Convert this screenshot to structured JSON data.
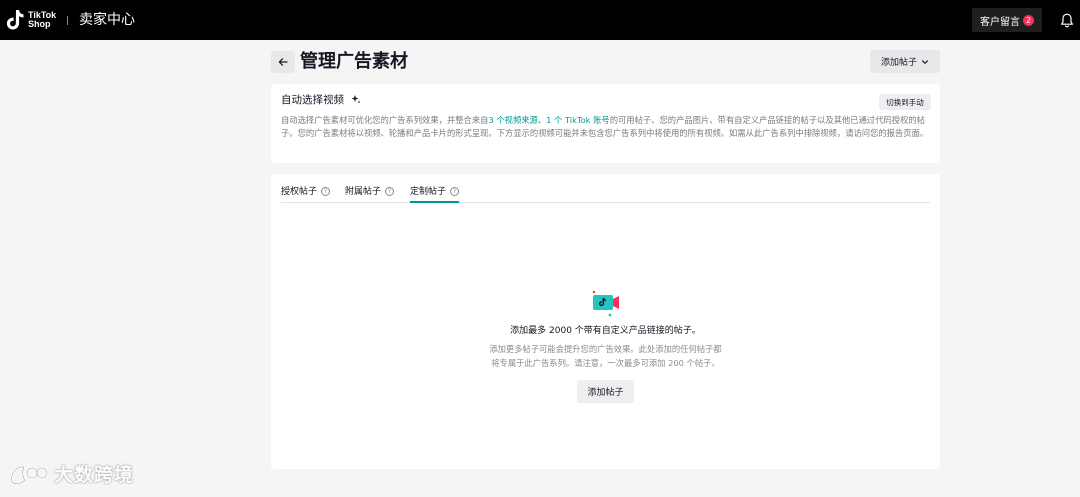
{
  "topbar": {
    "logo_line1": "TikTok",
    "logo_line2": "Shop",
    "app_title": "卖家中心",
    "customer_messages_label": "客户留言",
    "customer_messages_count": "2"
  },
  "header": {
    "page_title": "管理广告素材",
    "add_posts_label": "添加帖子"
  },
  "auto_select": {
    "title": "自动选择视频",
    "switch_label": "切换到手动",
    "desc_part1": "自动选择广告素材可优化您的广告系列效果，并整合来自",
    "desc_link1": "3 个视频来源、1 个 TikTok 账号",
    "desc_part2": "的可用帖子、您的产品图片、带有自定义产品链接的帖子以及其他已通过代码授权的帖子。您的广告素材将以视频、轮播和产品卡片的形式呈现。下方显示的视频可能并未包含您广告系列中将使用的所有视频。如需从此广告系列中排除视频，请访问您的报告页面。"
  },
  "tabs": [
    {
      "label": "授权帖子"
    },
    {
      "label": "附属帖子"
    },
    {
      "label": "定制帖子"
    }
  ],
  "empty_state": {
    "title": "添加最多 2000 个带有自定义产品链接的帖子。",
    "desc_line1": "添加更多帖子可能会提升您的广告效果。此处添加的任何帖子都",
    "desc_line2": "将专属于此广告系列。请注意，一次最多可添加 200 个帖子。",
    "button_label": "添加帖子"
  },
  "watermark": {
    "text": "大数跨境"
  },
  "colors": {
    "accent": "#009995",
    "badge": "#fe2c55",
    "topbar": "#000000"
  }
}
